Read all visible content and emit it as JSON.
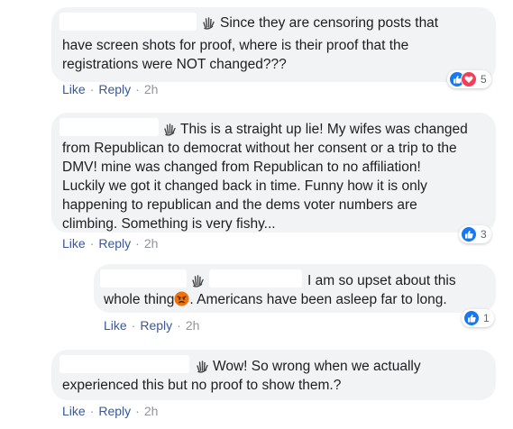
{
  "comments": [
    {
      "lines": [
        "Since they are censoring posts that",
        "have screen shots for proof, where is their proof that the",
        "registrations were NOT changed???"
      ],
      "actions": {
        "like": "Like",
        "reply": "Reply",
        "time": "2h"
      },
      "reactions": {
        "types": [
          "like",
          "love"
        ],
        "count": "5"
      }
    },
    {
      "lines": [
        "This is a straight up lie! My wifes was changed",
        "from Republican to democrat without her consent or a trip to the",
        "DMV! mine was changed from Republican to no affiliation!",
        "Luckily we got it changed back in time. Funny how it is only",
        "happening to republican and the dems voter numbers are",
        "climbing. Something is very fishy..."
      ],
      "actions": {
        "like": "Like",
        "reply": "Reply",
        "time": "2h"
      },
      "reactions": {
        "types": [
          "like"
        ],
        "count": "3"
      }
    },
    {
      "reply": true,
      "lines": [
        "I am so upset about this",
        "whole thing",
        ". Americans have been asleep far to long."
      ],
      "emoji": "angry-face",
      "actions": {
        "like": "Like",
        "reply": "Reply",
        "time": "2h"
      },
      "reactions": {
        "types": [
          "like"
        ],
        "count": "1"
      }
    },
    {
      "lines": [
        "Wow! So wrong when we actually",
        "experienced this but no proof to show them.?"
      ],
      "actions": {
        "like": "Like",
        "reply": "Reply",
        "time": "2h"
      }
    }
  ],
  "separator": "·",
  "colors": {
    "bubble": "#f2f3f5",
    "link": "#385898",
    "meta": "#90949c",
    "like": "#1877f2",
    "love": "#f33e58",
    "angry": "#e9710f"
  },
  "icons": {
    "wave": "waving-hand-icon",
    "like": "thumbs-up-icon",
    "love": "heart-icon"
  }
}
